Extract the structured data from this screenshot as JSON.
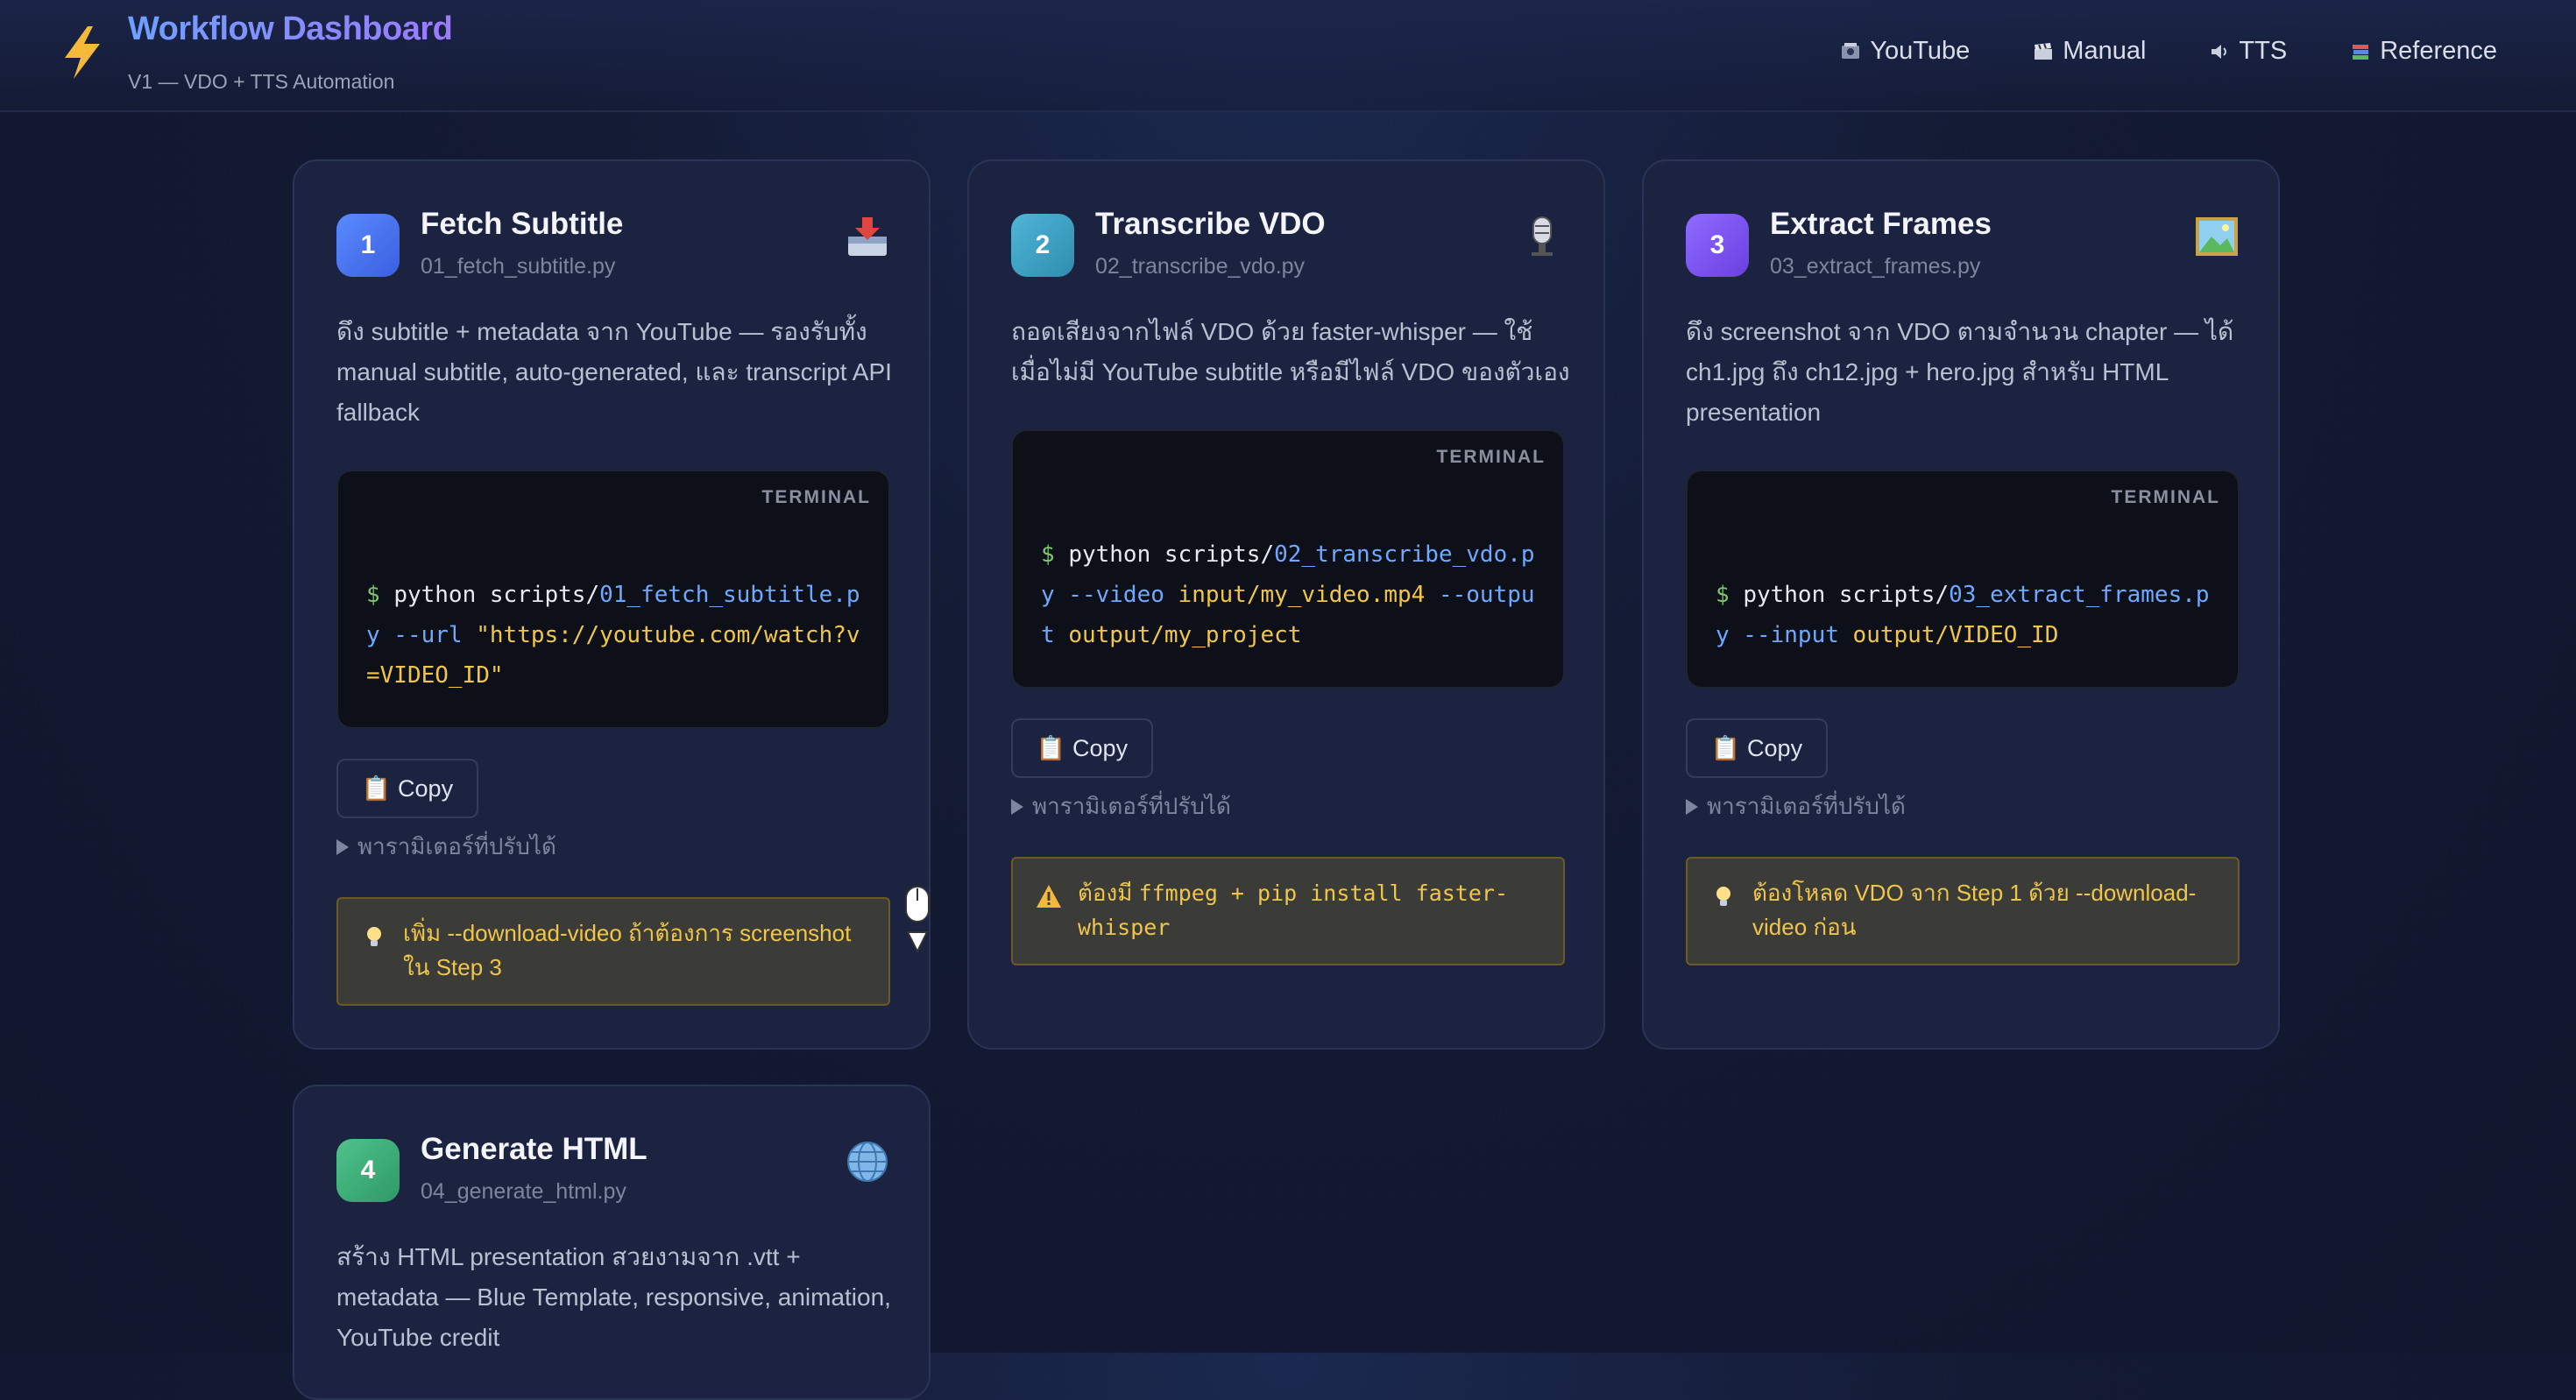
{
  "header": {
    "title": "Workflow Dashboard",
    "subtitle": "V1 — VDO + TTS Automation",
    "nav": [
      {
        "label": "YouTube",
        "icon": "film-icon"
      },
      {
        "label": "Manual",
        "icon": "clapper-icon"
      },
      {
        "label": "TTS",
        "icon": "speaker-icon"
      },
      {
        "label": "Reference",
        "icon": "books-icon"
      }
    ]
  },
  "colors": {
    "accent_blue": "#4f7bff",
    "accent_teal": "#3fa7c9",
    "accent_purple": "#7b55ff",
    "accent_green": "#3fb07a",
    "warning_text": "#f0c64a"
  },
  "steps": [
    {
      "number": "1",
      "title": "Fetch Subtitle",
      "file": "01_fetch_subtitle.py",
      "icon": "inbox-icon",
      "desc": "ดึง subtitle + metadata จาก YouTube — รองรับทั้ง manual subtitle, auto-generated, และ transcript API fallback",
      "terminal_label": "TERMINAL",
      "cmd": {
        "prompt": "$",
        "p1": "python scripts/",
        "p2": "01_fetch_subtitle.py",
        "p3": " --url ",
        "p4": "\"https://youtube.com/watch?v=VIDEO_ID\""
      },
      "copy": "📋 Copy",
      "params": "พารามิเตอร์ที่ปรับได้",
      "note": "เพิ่ม --download-video ถ้าต้องการ screenshot ใน Step 3",
      "note_icon": "lightbulb-icon"
    },
    {
      "number": "2",
      "title": "Transcribe VDO",
      "file": "02_transcribe_vdo.py",
      "icon": "microphone-icon",
      "desc": "ถอดเสียงจากไฟล์ VDO ด้วย faster-whisper — ใช้เมื่อไม่มี YouTube subtitle หรือมีไฟล์ VDO ของตัวเอง",
      "terminal_label": "TERMINAL",
      "cmd": {
        "prompt": "$",
        "p1": "python scripts/",
        "p2": "02_transcribe_vdo.py",
        "p3": " --video ",
        "p4": "input/my_video.mp4",
        "p5": " --output ",
        "p6": "output/my_project"
      },
      "copy": "📋 Copy",
      "params": "พารามิเตอร์ที่ปรับได้",
      "note_a": "ต้องมี ",
      "note_b": "ffmpeg + pip install faster-whisper",
      "note_icon": "warning-icon"
    },
    {
      "number": "3",
      "title": "Extract Frames",
      "file": "03_extract_frames.py",
      "icon": "picture-icon",
      "desc": "ดึง screenshot จาก VDO ตามจำนวน chapter — ได้ ch1.jpg ถึง ch12.jpg + hero.jpg สำหรับ HTML presentation",
      "terminal_label": "TERMINAL",
      "cmd": {
        "prompt": "$",
        "p1": "python scripts/",
        "p2": "03_extract_frames.py",
        "p3": " --input ",
        "p4": "output/VIDEO_ID"
      },
      "copy": "📋 Copy",
      "params": "พารามิเตอร์ที่ปรับได้",
      "note": "ต้องโหลด VDO จาก Step 1 ด้วย --download-video ก่อน",
      "note_icon": "lightbulb-icon"
    },
    {
      "number": "4",
      "title": "Generate HTML",
      "file": "04_generate_html.py",
      "icon": "globe-icon",
      "desc": "สร้าง HTML presentation สวยงามจาก .vtt + metadata — Blue Template, responsive, animation, YouTube credit"
    }
  ]
}
